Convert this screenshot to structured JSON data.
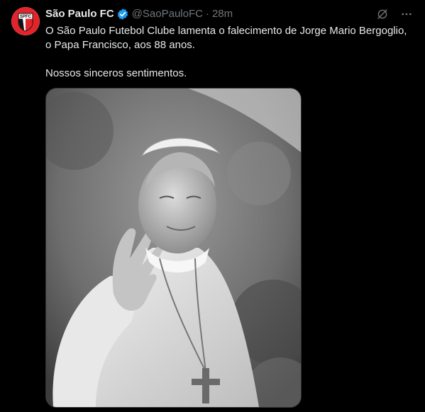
{
  "author": {
    "name": "São Paulo FC",
    "handle": "@SaoPauloFC",
    "separator": "·",
    "time": "28m",
    "avatar_text": "SPFC",
    "verified": true
  },
  "tweet": {
    "paragraph1": "O São Paulo Futebol Clube lamenta o falecimento de Jorge Mario Bergoglio, o Papa Francisco, aos 88 anos.",
    "paragraph2": "Nossos sinceros sentimentos."
  },
  "icons": {
    "grok": "grok-icon",
    "more": "more-icon",
    "verified": "verified-badge-icon"
  },
  "colors": {
    "background": "#000000",
    "text": "#e7e9ea",
    "muted": "#71767b",
    "verified": "#1d9bf0",
    "spfc_red": "#e3242b"
  },
  "media": {
    "description_icon": "photo"
  }
}
